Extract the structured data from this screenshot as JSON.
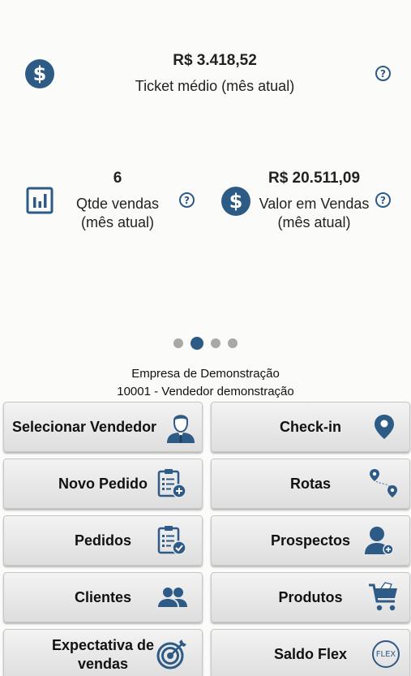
{
  "summary": {
    "ticket": {
      "value": "R$ 3.418,52",
      "label": "Ticket médio (mês atual)"
    },
    "qtde": {
      "value": "6",
      "label_line1": "Qtde vendas",
      "label_line2": "(mês atual)"
    },
    "valor": {
      "value": "R$ 20.511,09",
      "label_line1": "Valor em Vendas",
      "label_line2": "(mês atual)"
    },
    "dollar_symbol": "$",
    "help_symbol": "?"
  },
  "pager": {
    "count": 4,
    "active_index": 1
  },
  "company": {
    "name": "Empresa de Demonstração",
    "seller": "10001 - Vendedor demonstração"
  },
  "menu": {
    "selecionar_vendedor": "Selecionar Vendedor",
    "check_in": "Check-in",
    "novo_pedido": "Novo Pedido",
    "rotas": "Rotas",
    "pedidos": "Pedidos",
    "prospectos": "Prospectos",
    "clientes": "Clientes",
    "produtos": "Produtos",
    "expectativa_line1": "Expectativa de",
    "expectativa_line2": "vendas",
    "saldo_flex": "Saldo Flex",
    "flex_badge": "FLEX"
  },
  "colors": {
    "accent": "#2e5a86"
  }
}
